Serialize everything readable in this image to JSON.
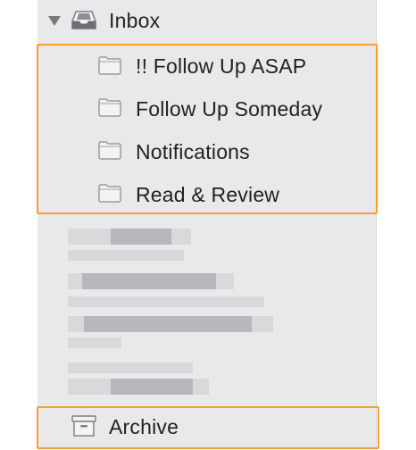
{
  "mailboxes": {
    "inbox_label": "Inbox",
    "subfolders": [
      {
        "label": "!! Follow Up ASAP",
        "icon": "folder-icon"
      },
      {
        "label": "Follow Up Someday",
        "icon": "folder-icon"
      },
      {
        "label": "Notifications",
        "icon": "folder-icon"
      },
      {
        "label": "Read & Review",
        "icon": "folder-icon"
      }
    ],
    "archive_label": "Archive"
  },
  "colors": {
    "sidebar_bg": "#e9e8ea",
    "highlight_border": "#f6a02e",
    "text": "#222222"
  }
}
